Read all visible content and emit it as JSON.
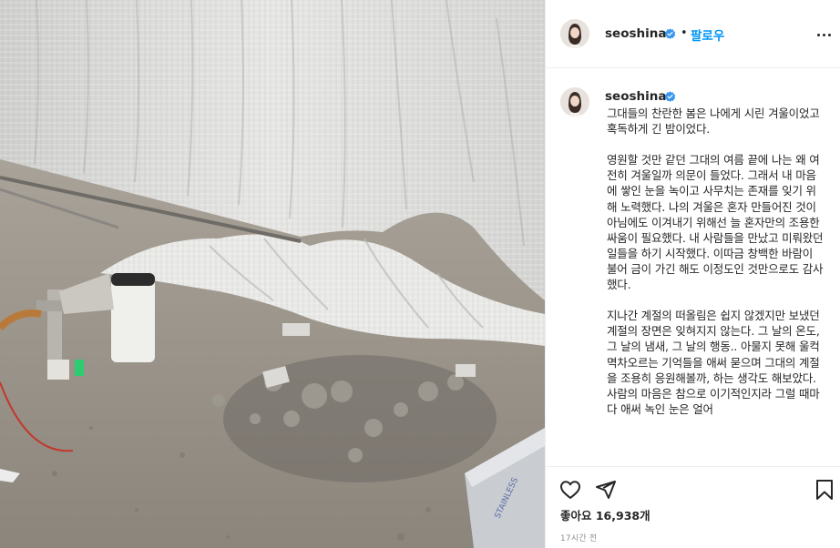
{
  "post": {
    "image_alt": "",
    "author": "seoshinae",
    "follow_label": "팔로우",
    "separator": "•",
    "caption": "그대들의 찬란한 봄은 나에게 시린 겨울이었고 혹독하게 긴 밤이었다.\n\n영원할 것만 같던 그대의 여름 끝에 나는 왜 여전히 겨울일까 의문이 들었다. 그래서 내 마음에 쌓인 눈을 녹이고 사무치는 존재를 잊기 위해 노력했다. 나의 겨울은 혼자 만들어진 것이 아님에도 이겨내기 위해선 늘 혼자만의 조용한 싸움이 필요했다. 내 사람들을 만났고 미뤄왔던 일들을 하기 시작했다. 이따금 창백한 바람이 불어 금이 가긴 해도 이정도인 것만으로도 감사했다.\n\n지나간 계절의 떠올림은 쉽지 않겠지만 보냈던 계절의 장면은 잊혀지지 않는다. 그 날의 온도, 그 날의 냄새, 그 날의 행동.. 아물지 못해 울컥 멱차오르는 기억들을 애써 묻으며 그대의 계절을 조용히 응원해볼까, 하는 생각도 해보았다. 사람의 마음은 참으로 이기적인지라 그럴 때마다 애써 녹인 눈은 얼어",
    "likes_text": "좋아요 16,938개",
    "time_ago": "17시간 전"
  },
  "colors": {
    "accent": "#0095f6",
    "verified": "#3897f0",
    "text": "#262626",
    "muted": "#8e8e8e"
  },
  "icons": {
    "verified": "verified-badge-icon",
    "more": "more-options-icon",
    "like": "heart-icon",
    "share": "paper-plane-icon",
    "save": "bookmark-icon"
  }
}
